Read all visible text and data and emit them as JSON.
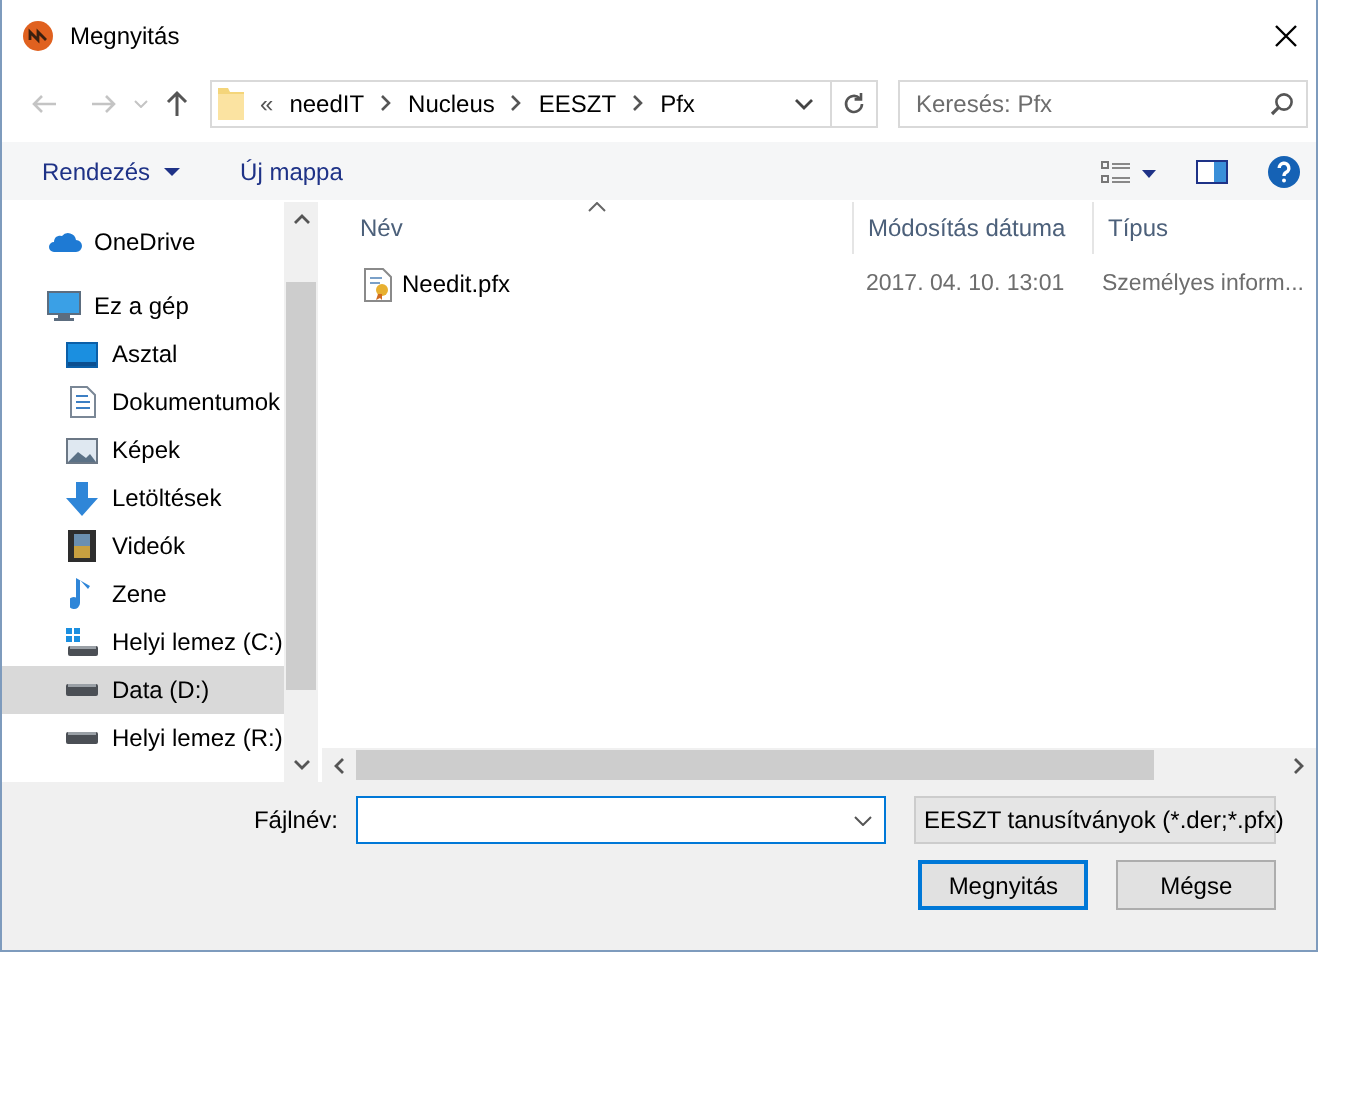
{
  "window": {
    "title": "Megnyitás"
  },
  "address": {
    "overflow": "«",
    "breadcrumbs": [
      "needIT",
      "Nucleus",
      "EESZT",
      "Pfx"
    ]
  },
  "search": {
    "placeholder": "Keresés: Pfx"
  },
  "toolbar": {
    "organize": "Rendezés",
    "new_folder": "Új mappa"
  },
  "sidebar": {
    "items": [
      {
        "label": "OneDrive",
        "kind": "cloud",
        "selected": false
      },
      {
        "label": "Ez a gép",
        "kind": "computer",
        "selected": false,
        "children": [
          {
            "label": "Asztal",
            "kind": "desktop",
            "selected": false
          },
          {
            "label": "Dokumentumok",
            "kind": "documents",
            "selected": false
          },
          {
            "label": "Képek",
            "kind": "pictures",
            "selected": false
          },
          {
            "label": "Letöltések",
            "kind": "download",
            "selected": false
          },
          {
            "label": "Videók",
            "kind": "video",
            "selected": false
          },
          {
            "label": "Zene",
            "kind": "music",
            "selected": false
          },
          {
            "label": "Helyi lemez (C:)",
            "kind": "system-drive",
            "selected": false
          },
          {
            "label": "Data (D:)",
            "kind": "drive",
            "selected": true
          },
          {
            "label": "Helyi lemez (R:)",
            "kind": "drive",
            "selected": false
          }
        ]
      }
    ]
  },
  "columns": [
    {
      "label": "Név",
      "sorted": true
    },
    {
      "label": "Módosítás dátuma",
      "sorted": false
    },
    {
      "label": "Típus",
      "sorted": false
    }
  ],
  "files": [
    {
      "name": "Needit.pfx",
      "modified": "2017. 04. 10. 13:01",
      "type": "Személyes inform...",
      "selected": false
    }
  ],
  "filename": {
    "label": "Fájlnév:"
  },
  "filter": {
    "value": "EESZT tanusítványok (*.der;*.pfx)"
  },
  "buttons": [
    {
      "label": "Megnyitás",
      "default": true
    },
    {
      "label": "Mégse",
      "default": false
    }
  ]
}
